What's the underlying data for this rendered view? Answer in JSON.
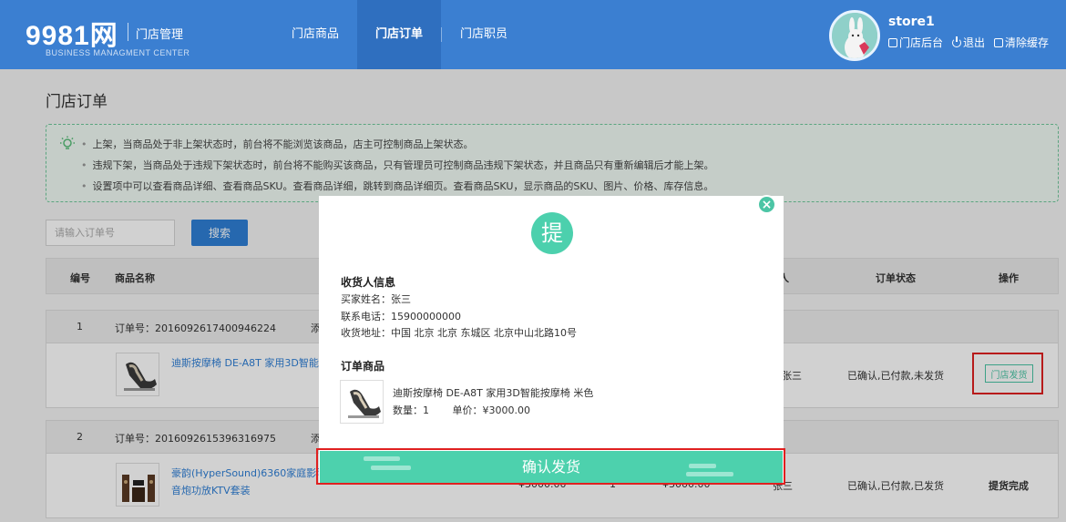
{
  "header": {
    "logo": "9981网",
    "logo_sub": "BUSINESS MANAGMENT CENTER",
    "app_title": "门店管理",
    "nav": [
      {
        "label": "门店商品"
      },
      {
        "label": "门店订单",
        "active": true
      },
      {
        "label": "门店职员"
      }
    ],
    "user": {
      "name": "store1",
      "links": [
        "门店后台",
        "退出",
        "清除缓存"
      ]
    }
  },
  "page": {
    "title": "门店订单",
    "notice": [
      "上架，当商品处于非上架状态时，前台将不能浏览该商品，店主可控制商品上架状态。",
      "违规下架，当商品处于违规下架状态时，前台将不能购买该商品，只有管理员可控制商品违规下架状态，并且商品只有重新编辑后才能上架。",
      "设置项中可以查看商品详细、查看商品SKU。查看商品详细，跳转到商品详细页。查看商品SKU，显示商品的SKU、图片、价格、库存信息。"
    ],
    "search": {
      "placeholder": "请输入订单号",
      "button": "搜索"
    },
    "table_headers": [
      "编号",
      "商品名称",
      "收货人",
      "订单状态",
      "操作"
    ],
    "orders": [
      {
        "index": "1",
        "order_no": "订单号：2016092617400946224",
        "added": "添",
        "product": "迪斯按摩椅 DE-A8T 家用3D智能",
        "receiver": "张三",
        "status": "已确认,已付款,未发货",
        "action": "门店发货"
      },
      {
        "index": "2",
        "order_no": "订单号：2016092615396316975",
        "added": "添",
        "product_line1": "豪韵(HyperSound)6360家庭影院",
        "product_line2": "音炮功放KTV套装",
        "price": "¥3000.00",
        "quantity": "1",
        "total": "¥3000.00",
        "receiver": "张三",
        "status": "已确认,已付款,已发货",
        "action": "提货完成"
      }
    ]
  },
  "modal": {
    "badge": "提",
    "receiver_title": "收货人信息",
    "buyer_name": "买家姓名：张三",
    "phone": "联系电话：15900000000",
    "address": "收货地址：中国 北京 北京 东城区 北京中山北路10号",
    "items_title": "订单商品",
    "item_name": "迪斯按摩椅 DE-A8T 家用3D智能按摩椅 米色",
    "item_qty": "数量：1",
    "item_price": "单价：¥3000.00",
    "confirm": "确认发货",
    "close": "×"
  },
  "colors": {
    "header": "#3b7fd1",
    "accent": "#4dd1ad",
    "link": "#2f7fd6",
    "highlight": "#e02020"
  }
}
